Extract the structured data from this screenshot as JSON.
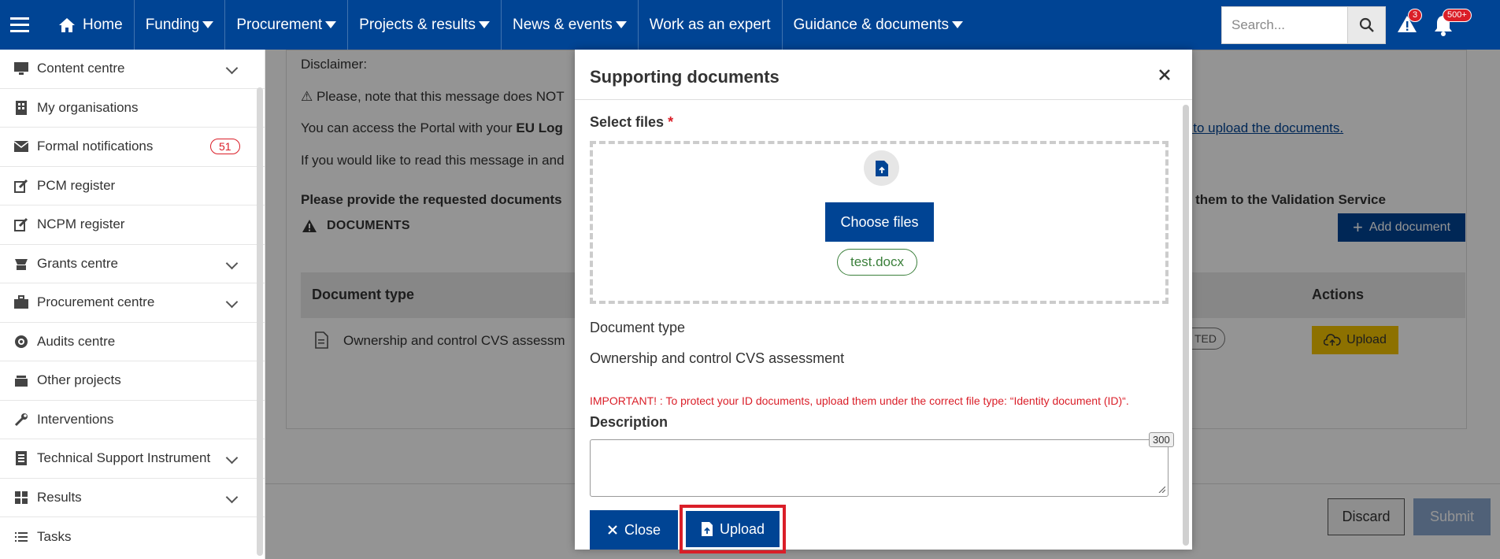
{
  "nav": {
    "home": "Home",
    "items": [
      "Funding",
      "Procurement",
      "Projects & results",
      "News & events",
      "Work as an expert",
      "Guidance & documents"
    ],
    "search_placeholder": "Search...",
    "alert_count": "3",
    "notification_count": "500+"
  },
  "sidebar": {
    "items": [
      {
        "label": "Content centre",
        "icon": "monitor-icon",
        "expandable": true
      },
      {
        "label": "My organisations",
        "icon": "building-icon"
      },
      {
        "label": "Formal notifications",
        "icon": "envelope-icon",
        "badge": "51"
      },
      {
        "label": "PCM register",
        "icon": "edit-icon"
      },
      {
        "label": "NCPM register",
        "icon": "edit-icon"
      },
      {
        "label": "Grants centre",
        "icon": "grants-icon",
        "expandable": true
      },
      {
        "label": "Procurement centre",
        "icon": "briefcase-icon",
        "expandable": true
      },
      {
        "label": "Audits centre",
        "icon": "target-icon"
      },
      {
        "label": "Other projects",
        "icon": "stack-icon"
      },
      {
        "label": "Interventions",
        "icon": "wrench-icon"
      },
      {
        "label": "Technical Support Instrument",
        "icon": "document-icon",
        "expandable": true
      },
      {
        "label": "Results",
        "icon": "grid-icon",
        "expandable": true
      },
      {
        "label": "Tasks",
        "icon": "list-icon"
      }
    ]
  },
  "background": {
    "disclaimer": "Disclaimer:",
    "note": "⚠ Please, note that this message does NOT",
    "access_prefix": "You can access the Portal with your ",
    "access_bold": "EU Log",
    "link_fragment": "k to upload the documents.",
    "read_msg": "If you would like to read this message in and",
    "provide_bold": "Please provide the requested documents",
    "validation_bold": "d them to the Validation Service",
    "documents_heading": "DOCUMENTS",
    "add_document": "Add document",
    "col_document_type": "Document type",
    "col_actions": "Actions",
    "row_document": "Ownership and control CVS assessm",
    "row_status": "TED",
    "row_upload": "Upload",
    "discard": "Discard",
    "submit": "Submit"
  },
  "modal": {
    "title": "Supporting documents",
    "select_files_label": "Select files",
    "required_mark": "*",
    "choose_files": "Choose files",
    "selected_file": "test.docx",
    "document_type_label": "Document type",
    "document_type_value": "Ownership and control CVS assessment",
    "important_note": "IMPORTANT! : To protect your ID documents, upload them under the correct file type: “Identity document (ID)“.",
    "description_label": "Description",
    "description_value": "",
    "char_limit": "300",
    "close": "Close",
    "upload": "Upload"
  },
  "colors": {
    "primary": "#004494",
    "danger": "#da1e28",
    "warning": "#f3c300",
    "success": "#3a7f3a"
  }
}
